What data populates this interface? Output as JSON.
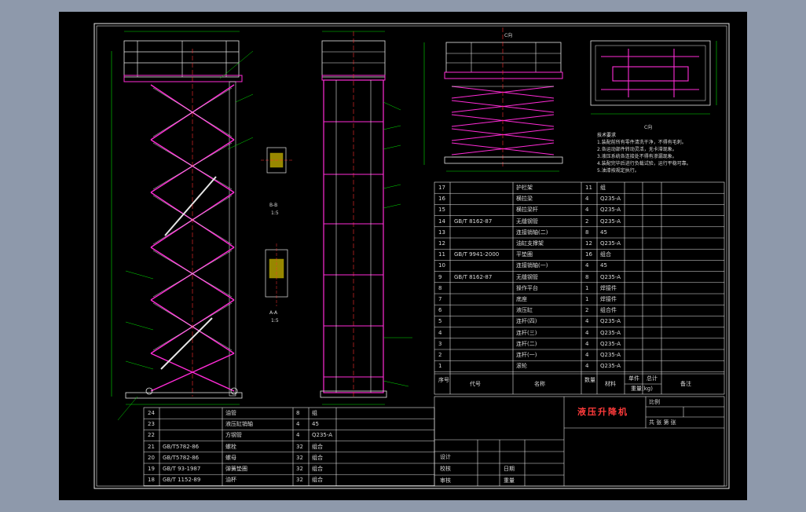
{
  "title_block": {
    "product_name": "液压升降机",
    "header_seq": "序号",
    "header_code": "代号",
    "header_name": "名称",
    "header_qty": "数量",
    "header_material": "材料",
    "header_weight_single": "单件",
    "header_weight_total": "总计",
    "header_weight": "重量(kg)",
    "header_note": "备注",
    "scale_label": "比例",
    "sheet_label": "共 张 第 张",
    "design_label": "设计",
    "check_label": "校核",
    "approve_label": "审核",
    "date_label": "日期",
    "weight_label": "重量"
  },
  "parts_upper": [
    {
      "seq": "17",
      "code": "",
      "name": "护栏架",
      "qty": "11",
      "mat": "组"
    },
    {
      "seq": "16",
      "code": "",
      "name": "横拉梁",
      "qty": "4",
      "mat": "Q235-A"
    },
    {
      "seq": "15",
      "code": "",
      "name": "横拉梁杆",
      "qty": "4",
      "mat": "Q235-A"
    },
    {
      "seq": "14",
      "code": "GB/T 8162-87",
      "name": "无缝钢管",
      "qty": "2",
      "mat": "Q235-A"
    },
    {
      "seq": "13",
      "code": "",
      "name": "连接销轴(二)",
      "qty": "8",
      "mat": "45"
    },
    {
      "seq": "12",
      "code": "",
      "name": "油缸支撑架",
      "qty": "12",
      "mat": "Q235-A"
    },
    {
      "seq": "11",
      "code": "GB/T 9941-2000",
      "name": "平垫圈",
      "qty": "16",
      "mat": "组合"
    },
    {
      "seq": "10",
      "code": "",
      "name": "连接销轴(一)",
      "qty": "4",
      "mat": "45"
    },
    {
      "seq": "9",
      "code": "GB/T 8162-87",
      "name": "无缝钢管",
      "qty": "8",
      "mat": "Q235-A"
    },
    {
      "seq": "8",
      "code": "",
      "name": "操作平台",
      "qty": "1",
      "mat": "焊接件"
    },
    {
      "seq": "7",
      "code": "",
      "name": "底座",
      "qty": "1",
      "mat": "焊接件"
    },
    {
      "seq": "6",
      "code": "",
      "name": "液压缸",
      "qty": "2",
      "mat": "组合件"
    },
    {
      "seq": "5",
      "code": "",
      "name": "连杆(四)",
      "qty": "4",
      "mat": "Q235-A"
    },
    {
      "seq": "4",
      "code": "",
      "name": "连杆(三)",
      "qty": "4",
      "mat": "Q235-A"
    },
    {
      "seq": "3",
      "code": "",
      "name": "连杆(二)",
      "qty": "4",
      "mat": "Q235-A"
    },
    {
      "seq": "2",
      "code": "",
      "name": "连杆(一)",
      "qty": "4",
      "mat": "Q235-A"
    },
    {
      "seq": "1",
      "code": "",
      "name": "滚轮",
      "qty": "4",
      "mat": "Q235-A"
    }
  ],
  "parts_lower": [
    {
      "seq": "24",
      "code": "",
      "name": "油管",
      "qty": "8",
      "mat": "组"
    },
    {
      "seq": "23",
      "code": "",
      "name": "液压缸销轴",
      "qty": "4",
      "mat": "45"
    },
    {
      "seq": "22",
      "code": "",
      "name": "方钢管",
      "qty": "4",
      "mat": "Q235-A"
    },
    {
      "seq": "21",
      "code": "GB/T5782-86",
      "name": "螺栓",
      "qty": "32",
      "mat": "组合"
    },
    {
      "seq": "20",
      "code": "GB/T5782-86",
      "name": "螺母",
      "qty": "32",
      "mat": "组合"
    },
    {
      "seq": "19",
      "code": "GB/T 93-1987",
      "name": "弹簧垫圈",
      "qty": "32",
      "mat": "组合"
    },
    {
      "seq": "18",
      "code": "GB/T 1152-89",
      "name": "油杯",
      "qty": "32",
      "mat": "组合"
    }
  ],
  "notes": [
    "1.装配前所有零件清洗干净，不得有毛刺。",
    "2.各运动部件转动灵活，无卡滞现象。",
    "3.液压系统各连接处不得有渗漏现象。",
    "4.装配完毕后进行负载试验，运行平稳可靠。",
    "5.油漆按规定执行。"
  ],
  "labels": {
    "section_bb": "B-B",
    "section_aa": "A-A",
    "scale_bb": "1:5",
    "scale_aa": "1:5",
    "view_c": "C向",
    "view_c_bottom": "C向",
    "note_title": "技术要求"
  },
  "colors": {
    "background": "#8e99ab",
    "sheet": "#000000",
    "line_white": "#e6e6e6",
    "line_magenta": "#ff2bd6",
    "line_green": "#00e000",
    "line_red": "#ff3030",
    "line_yellow": "#e8e000"
  }
}
